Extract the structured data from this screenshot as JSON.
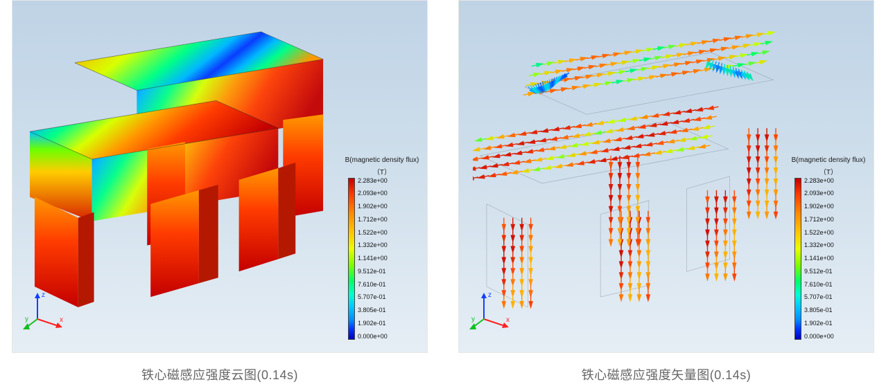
{
  "panels": [
    {
      "caption": "铁心磁感应强度云图(0.14s)",
      "legend": {
        "title": "B(magnetic density flux)",
        "unit": "（T）",
        "ticks": [
          "2.283e+00",
          "2.093e+00",
          "1.902e+00",
          "1.712e+00",
          "1.522e+00",
          "1.332e+00",
          "1.141e+00",
          "9.512e-01",
          "7.610e-01",
          "5.707e-01",
          "3.805e-01",
          "1.902e-01",
          "0.000e+00"
        ]
      },
      "axes": {
        "x": "x",
        "y": "y",
        "z": "z"
      },
      "viz_type": "contour"
    },
    {
      "caption": "铁心磁感应强度矢量图(0.14s)",
      "legend": {
        "title": "B(magnetic density flux)",
        "unit": "（T）",
        "ticks": [
          "2.283e+00",
          "2.093e+00",
          "1.902e+00",
          "1.712e+00",
          "1.522e+00",
          "1.332e+00",
          "1.141e+00",
          "9.512e-01",
          "7.610e-01",
          "5.707e-01",
          "3.805e-01",
          "1.902e-01",
          "0.000e+00"
        ]
      },
      "axes": {
        "x": "x",
        "y": "y",
        "z": "z"
      },
      "viz_type": "vector"
    }
  ],
  "chart_data": {
    "field": "B (magnetic flux density)",
    "unit": "T",
    "time_s": 0.14,
    "range": {
      "min": 0.0,
      "max": 2.283
    },
    "colorbar_ticks": [
      2.283,
      2.093,
      1.902,
      1.712,
      1.522,
      1.332,
      1.141,
      0.9512,
      0.761,
      0.5707,
      0.3805,
      0.1902,
      0.0
    ],
    "views": [
      {
        "type": "contour",
        "description": "Iron-core magnetic flux density magnitude contour at 0.14 s"
      },
      {
        "type": "vector",
        "description": "Iron-core magnetic flux density vector field at 0.14 s"
      }
    ]
  }
}
